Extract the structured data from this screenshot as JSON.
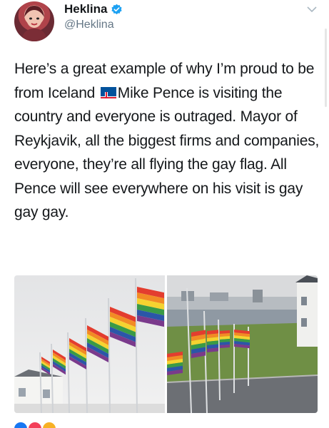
{
  "author": {
    "name": "Heklina",
    "handle": "@Heklina",
    "verified": true
  },
  "tweet": {
    "text_before_flag": "Here’s a great example of why I’m proud to be from Iceland ",
    "flag_icon": "iceland-flag-icon",
    "text_after_flag": "Mike Pence is visiting the country and everyone is outraged. Mayor of Reykjavik, all the biggest firms and companies, everyone, they’re all flying the gay flag. All Pence will see everywhere on his visit is gay gay gay."
  },
  "media": {
    "images": [
      "rainbow-flags-left-photo",
      "rainbow-flags-right-photo"
    ]
  },
  "colors": {
    "verified_blue": "#1da1f2",
    "handle_gray": "#657786",
    "text": "#14171a"
  }
}
